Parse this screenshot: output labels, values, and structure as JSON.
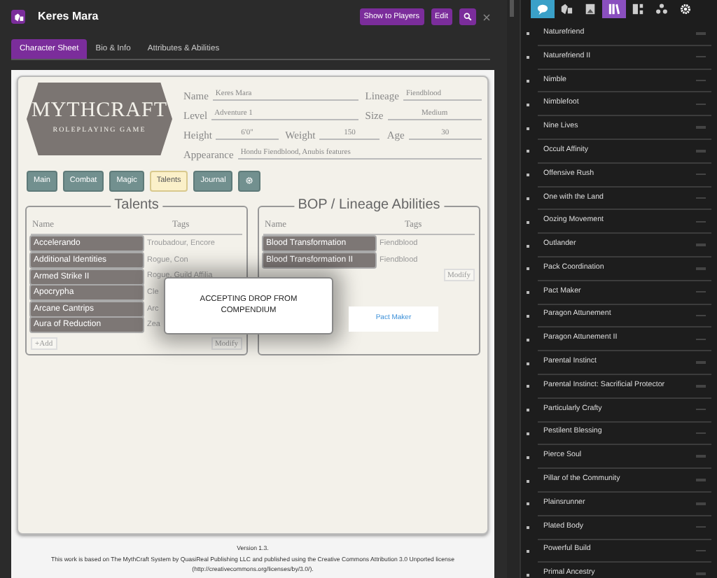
{
  "window": {
    "title": "Keres Mara"
  },
  "header_buttons": [
    {
      "label": "Show to Players",
      "kind": "text"
    },
    {
      "label": "Edit",
      "kind": "text"
    },
    {
      "kind": "search"
    }
  ],
  "tabs": [
    {
      "label": "Character Sheet",
      "selected": true
    },
    {
      "label": "Bio & Info",
      "selected": false
    },
    {
      "label": "Attributes & Abilities",
      "selected": false
    }
  ],
  "logo": {
    "title": "MYTHCRAFT",
    "subtitle": "ROLEPLAYING GAME"
  },
  "fields": [
    [
      {
        "label": "Name",
        "value": "Keres Mara"
      },
      {
        "label": "Lineage",
        "value": "Fiendblood"
      }
    ],
    [
      {
        "label": "Level",
        "value": "Adventure 1"
      },
      {
        "label": "Size",
        "value": "Medium"
      }
    ],
    [
      {
        "label": "Height",
        "value": "6'0\""
      },
      {
        "label": "Weight",
        "value": "150"
      },
      {
        "label": "Age",
        "value": "30"
      }
    ],
    [
      {
        "label": "Appearance",
        "value": "Hondu Fiendblood, Anubis features"
      }
    ]
  ],
  "sheet_tabs": [
    {
      "label": "Main",
      "kind": "text",
      "selected": false
    },
    {
      "label": "Combat",
      "kind": "text",
      "selected": false
    },
    {
      "label": "Magic",
      "kind": "text",
      "selected": false
    },
    {
      "label": "Talents",
      "kind": "text",
      "selected": true
    },
    {
      "label": "Journal",
      "kind": "text",
      "selected": false
    },
    {
      "kind": "gear",
      "selected": false
    }
  ],
  "sections": [
    {
      "title": "Talents",
      "columns": [
        "Name",
        "Tags"
      ],
      "rows": [
        {
          "name": "Accelerando",
          "tags": "Troubadour, Encore"
        },
        {
          "name": "Additional Identities",
          "tags": "Rogue, Con"
        },
        {
          "name": "Armed Strike II",
          "tags": "Rogue, Guild Affilia"
        },
        {
          "name": "Apocrypha",
          "tags": "Cle"
        },
        {
          "name": "Arcane Cantrips",
          "tags": "Arc"
        },
        {
          "name": "Aura of Reduction",
          "tags": "Zea"
        }
      ],
      "add": "+Add",
      "modify": "Modify"
    },
    {
      "title": "BOP / Lineage Abilities",
      "columns": [
        "Name",
        "Tags"
      ],
      "rows": [
        {
          "name": "Blood Transformation",
          "tags": "Fiendblood"
        },
        {
          "name": "Blood Transformation II",
          "tags": "Fiendblood"
        }
      ],
      "modify": "Modify"
    }
  ],
  "drop_dialog": {
    "text": "ACCEPTING DROP FROM COMPENDIUM"
  },
  "drag_item": {
    "label": "Pact Maker"
  },
  "footer": {
    "version": "Version 1.3.",
    "license": "This work is based on The MythCraft System by QuasiReal Publishing LLC and published using the Creative Commons Attribution 3.0 Unported license (http://creativecommons.org/licenses/by/3.0/)."
  },
  "sidebar_tabs": [
    {
      "kind": "chat",
      "highlighted": true,
      "selected": false
    },
    {
      "kind": "dice",
      "highlighted": false,
      "selected": false
    },
    {
      "kind": "image",
      "highlighted": false,
      "selected": false
    },
    {
      "kind": "books",
      "highlighted": false,
      "selected": true
    },
    {
      "kind": "sheet",
      "highlighted": false,
      "selected": false
    },
    {
      "kind": "people",
      "highlighted": false,
      "selected": false
    },
    {
      "kind": "gear",
      "highlighted": false,
      "selected": false
    }
  ],
  "compendium_items": [
    "Naturefriend",
    "Naturefriend II",
    "Nimble",
    "Nimblefoot",
    "Nine Lives",
    "Occult Affinity",
    "Offensive Rush",
    "One with the Land",
    "Oozing Movement",
    "Outlander",
    "Pack Coordination",
    "Pact Maker",
    "Paragon Attunement",
    "Paragon Attunement II",
    "Parental Instinct",
    "Parental Instinct: Sacrificial Protector",
    "Particularly Crafty",
    "Pestilent Blessing",
    "Pierce Soul",
    "Pillar of the Community",
    "Plainsrunner",
    "Plated Body",
    "Powerful Build",
    "Primal Ancestry"
  ]
}
